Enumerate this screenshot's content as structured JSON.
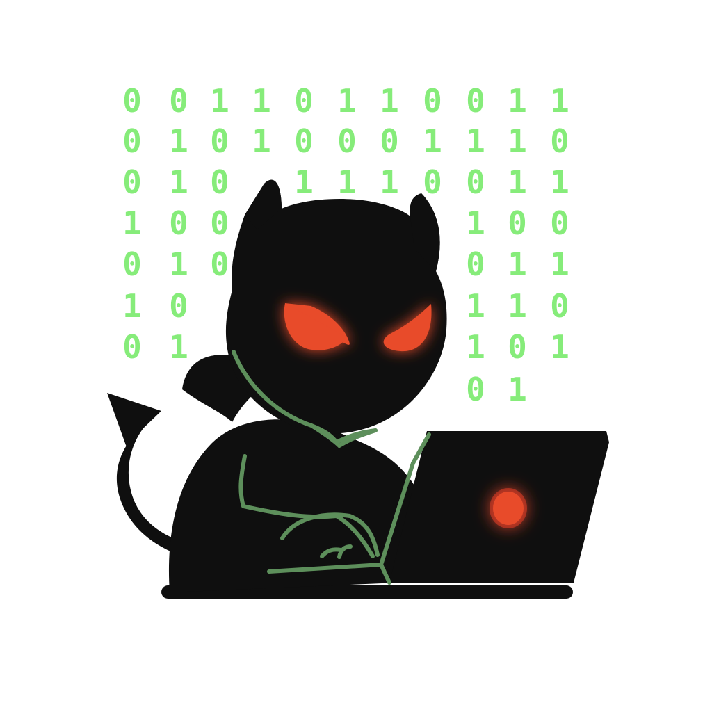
{
  "colors": {
    "background": "#ffffff",
    "binary_green": "#86ec7a",
    "silhouette": "#0f0f0f",
    "outline_green": "#5d8f5b",
    "eye_red": "#e84b2b",
    "laptop_glow": "#e63e26"
  },
  "binary_rows": [
    "0 0 1 1 0 1 1 0 0 1 1",
    "0 1 0 1 0 0 0 1 1 1 0",
    "0 1 0 _ 1 1 1 0 0 1 1",
    "1 0 0 _ _ _ _ _ 1 0 0",
    "0 1 0 _ _ _ _ _ 0 1 1",
    "1 0 _ _ _ _ _ _ 1 1 0",
    "0 1 _ _ _ _ _ _ 1 0 1",
    "_ _ _ _ _ _ _ _ 0 1 _"
  ],
  "figure": {
    "character": "devil-hacker silhouette",
    "eye_icon": "angry-eye-icon",
    "tail_icon": "devil-tail-icon",
    "horn_icon": "horn-icon",
    "laptop_logo_icon": "laptop-logo-icon"
  }
}
